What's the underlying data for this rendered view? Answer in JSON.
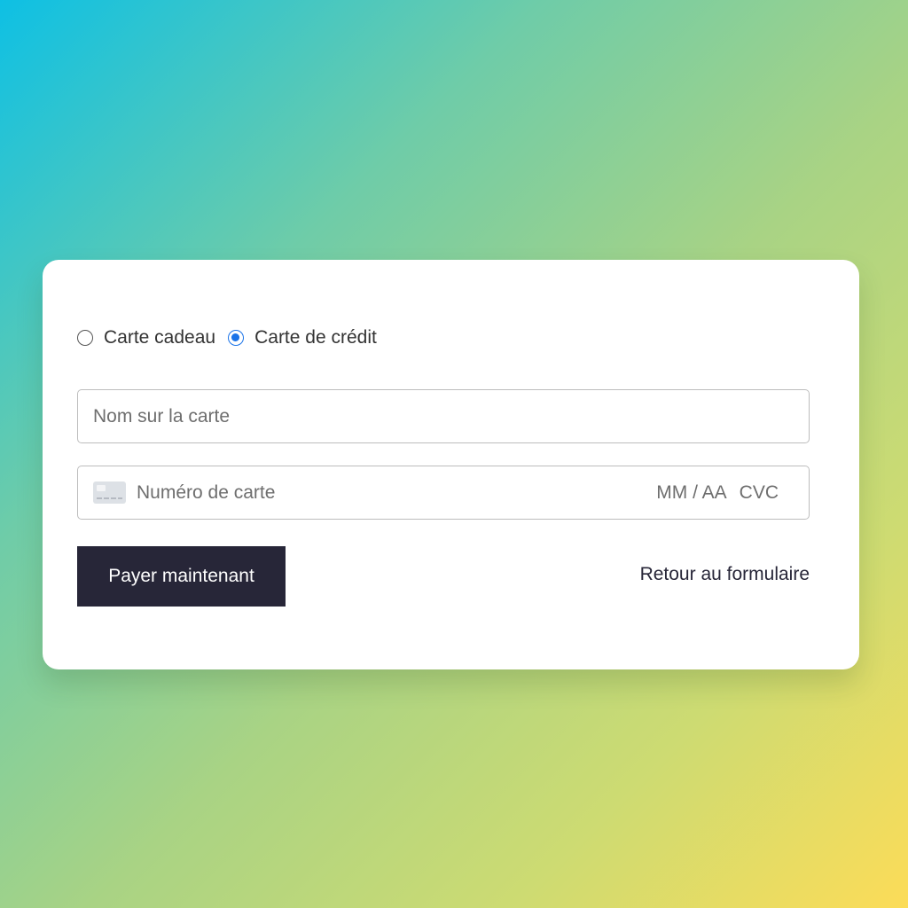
{
  "payment_method": {
    "options": [
      {
        "label": "Carte cadeau",
        "selected": false
      },
      {
        "label": "Carte de crédit",
        "selected": true
      }
    ],
    "accent_color": "#1a73e8"
  },
  "form": {
    "name_placeholder": "Nom sur la carte",
    "card_number_placeholder": "Numéro de carte",
    "expiry_placeholder": "MM / AA",
    "cvc_placeholder": "CVC",
    "card_icon": "credit-card-icon"
  },
  "actions": {
    "pay_label": "Payer maintenant",
    "pay_color": "#272638",
    "back_label": "Retour au formulaire"
  }
}
